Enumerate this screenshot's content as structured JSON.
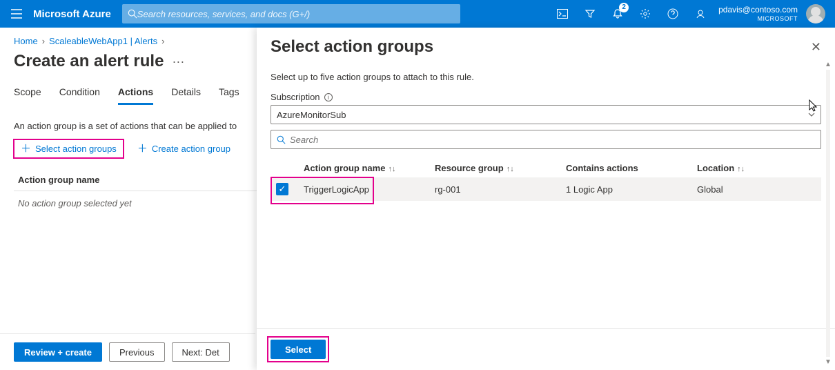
{
  "topbar": {
    "brand": "Microsoft Azure",
    "search_placeholder": "Search resources, services, and docs (G+/)",
    "notif_count": "2",
    "user_email": "pdavis@contoso.com",
    "user_tenant": "MICROSOFT"
  },
  "breadcrumb": {
    "home": "Home",
    "p1": "ScaleableWebApp1 | Alerts"
  },
  "page_title": "Create an alert rule",
  "tabs": {
    "scope": "Scope",
    "condition": "Condition",
    "actions": "Actions",
    "details": "Details",
    "tags": "Tags"
  },
  "body_desc": "An action group is a set of actions that can be applied to",
  "cmds": {
    "select": "Select action groups",
    "create": "Create action group"
  },
  "ag_table": {
    "header": "Action group name",
    "empty": "No action group selected yet"
  },
  "bottom": {
    "review": "Review + create",
    "prev": "Previous",
    "next": "Next: Det"
  },
  "flyout": {
    "title": "Select action groups",
    "desc": "Select up to five action groups to attach to this rule.",
    "sub_label": "Subscription",
    "sub_value": "AzureMonitorSub",
    "search_placeholder": "Search",
    "cols": {
      "name": "Action group name",
      "rg": "Resource group",
      "contains": "Contains actions",
      "loc": "Location"
    },
    "rows": [
      {
        "name": "TriggerLogicApp",
        "rg": "rg-001",
        "contains": "1 Logic App",
        "loc": "Global",
        "checked": true
      }
    ],
    "select_btn": "Select"
  }
}
